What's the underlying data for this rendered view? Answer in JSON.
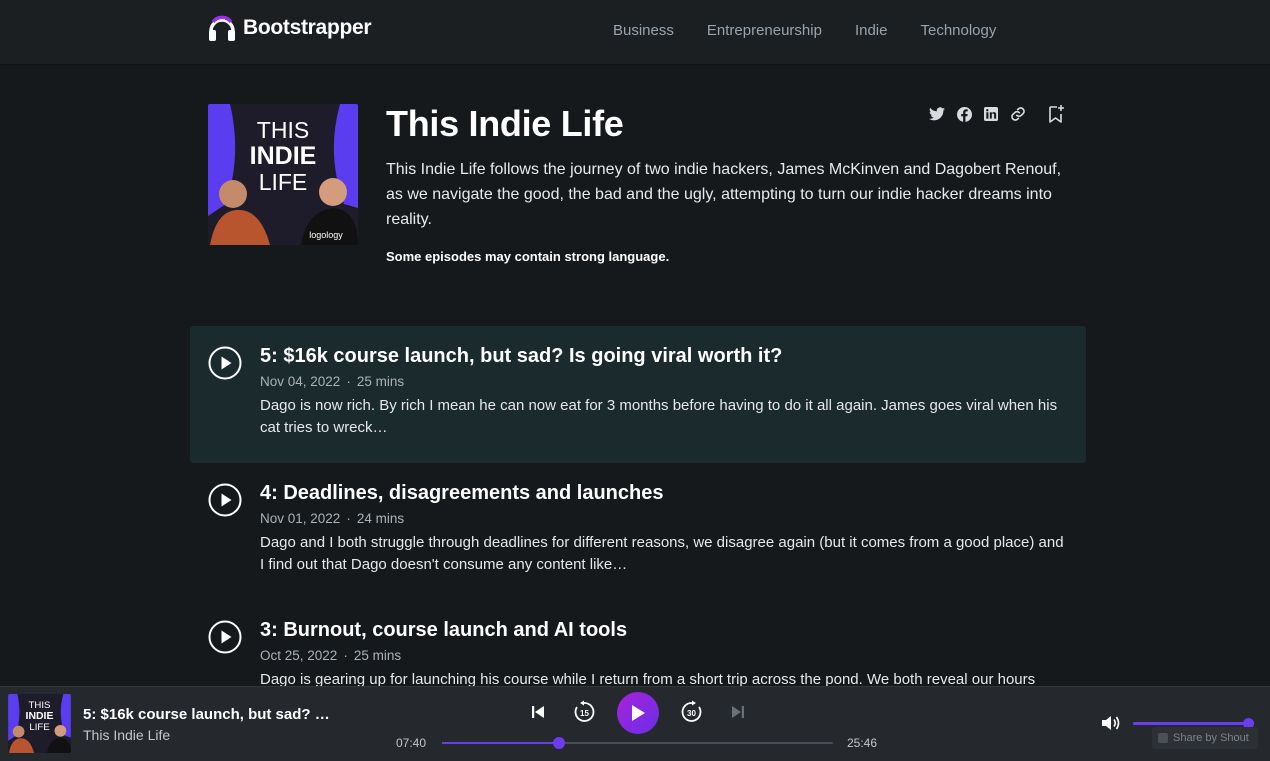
{
  "brand": {
    "name": "Bootstrapper",
    "accent": "#6b3df0",
    "gradient_start": "#a722d9"
  },
  "nav": [
    "Business",
    "Entrepreneurship",
    "Indie",
    "Technology"
  ],
  "podcast": {
    "title": "This Indie Life",
    "description": "This Indie Life follows the journey of two indie hackers, James McKinven and Dagobert Renouf, as we navigate the good, the bad and the ugly, attempting to turn our indie hacker dreams into reality.",
    "warning": "Some episodes may contain strong language.",
    "cover_text": [
      "THIS",
      "INDIE",
      "LIFE"
    ],
    "cover_shirt_text": "logology"
  },
  "share_icons": [
    "twitter-icon",
    "facebook-icon",
    "linkedin-icon",
    "link-icon"
  ],
  "bookmark_icon": "bookmark-add-icon",
  "episodes": [
    {
      "title": "5: $16k course launch, but sad? Is going viral worth it?",
      "date": "Nov 04, 2022",
      "duration": "25 mins",
      "description": "Dago is now rich. By rich I mean he can now eat for 3 months before having to do it all again. James goes viral when his cat tries to wreck…"
    },
    {
      "title": "4: Deadlines, disagreements and launches",
      "date": "Nov 01, 2022",
      "duration": "24 mins",
      "description": "Dago and I both struggle through deadlines for different reasons, we disagree again (but it comes from a good place) and I find out that Dago doesn't consume any content like…"
    },
    {
      "title": "3: Burnout, course launch and AI tools",
      "date": "Oct 25, 2022",
      "duration": "25 mins",
      "description": "Dago is gearing up for launching his course while I return from a short trip across the pond. We both reveal our hours"
    }
  ],
  "meta_separator": "·",
  "player": {
    "title": "5: $16k course launch, but sad? …",
    "show": "This Indie Life",
    "current_time": "07:40",
    "duration": "25:46",
    "progress": 0.298,
    "volume": 1.0,
    "back_seconds": "15",
    "forward_seconds": "30",
    "powered_by": "Share by Shout"
  }
}
